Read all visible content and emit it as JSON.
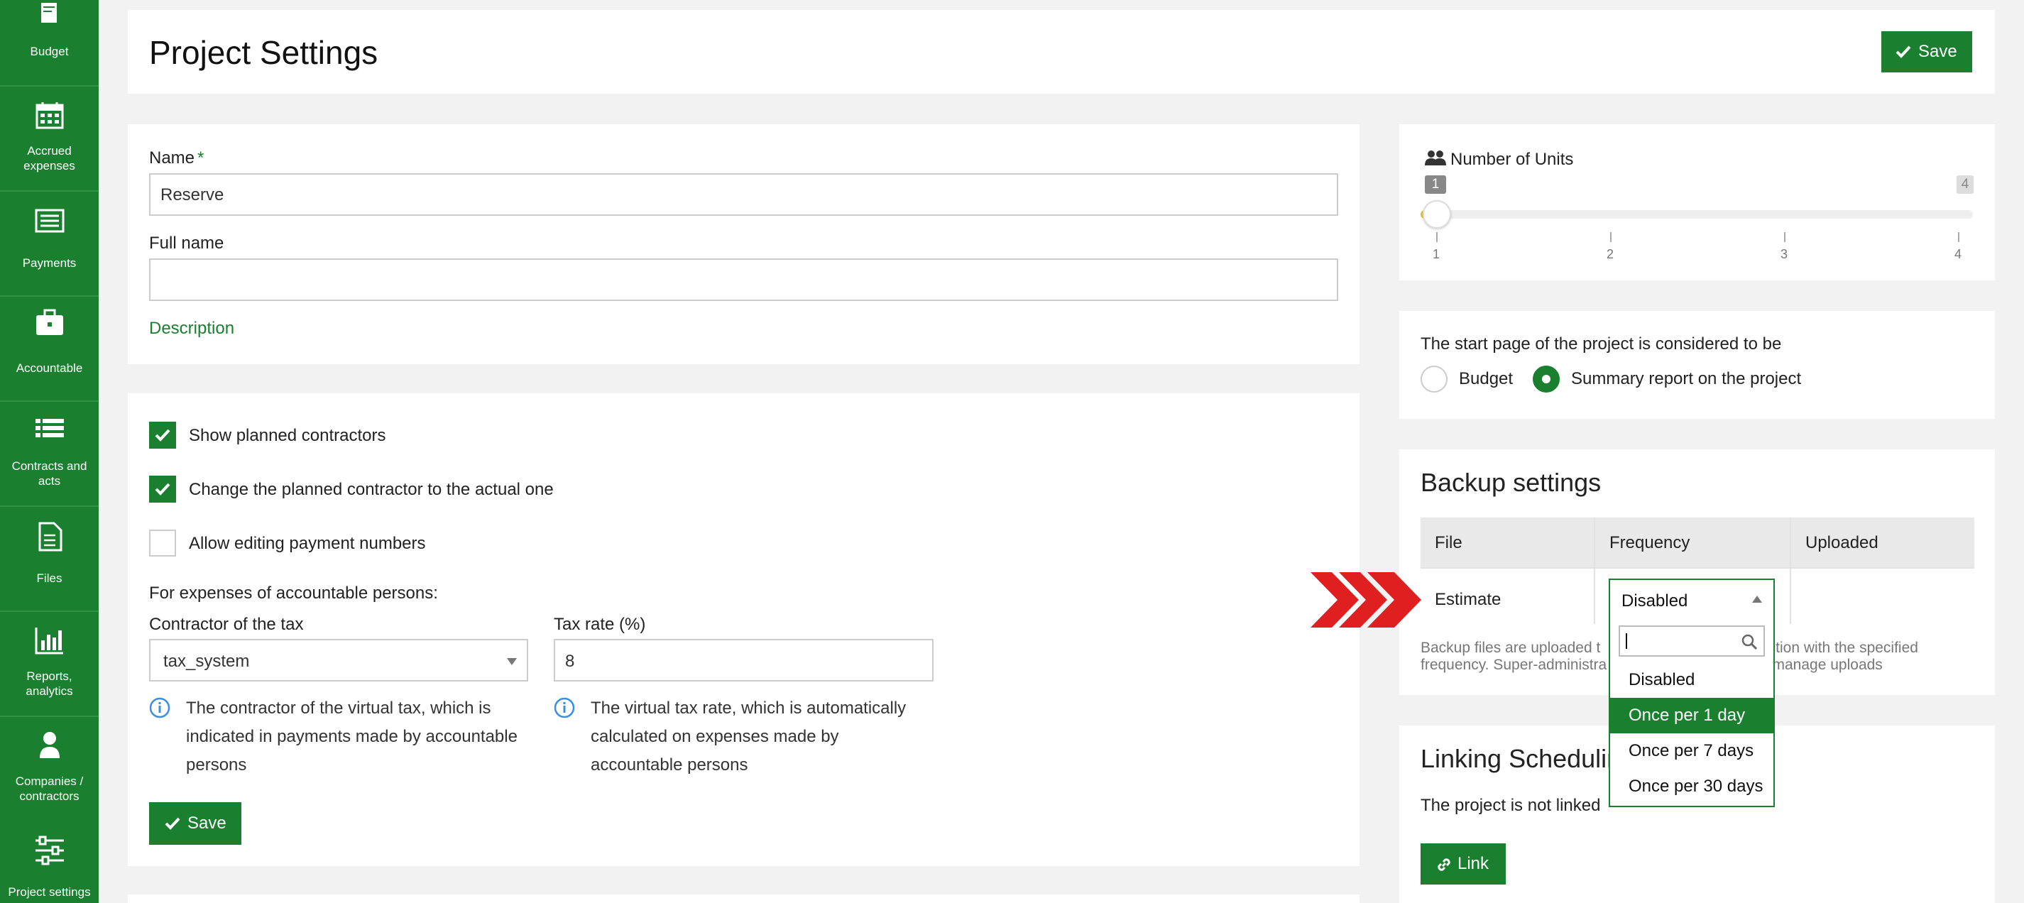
{
  "sidebar": {
    "items": [
      {
        "label": "Budget",
        "icon": "book-icon"
      },
      {
        "label": "Accrued expenses",
        "icon": "calendar-icon"
      },
      {
        "label": "Payments",
        "icon": "list-card-icon"
      },
      {
        "label": "Accountable",
        "icon": "briefcase-icon"
      },
      {
        "label": "Contracts and acts",
        "icon": "list-icon"
      },
      {
        "label": "Files",
        "icon": "file-icon"
      },
      {
        "label": "Reports, analytics",
        "icon": "bar-chart-icon"
      },
      {
        "label": "Companies / contractors",
        "icon": "user-icon"
      },
      {
        "label": "Project settings",
        "icon": "sliders-icon"
      }
    ]
  },
  "header": {
    "title": "Project Settings",
    "save_label": "Save"
  },
  "general": {
    "name_label": "Name",
    "required_mark": "*",
    "name_value": "Reserve",
    "fullname_label": "Full name",
    "fullname_value": "",
    "description_link": "Description"
  },
  "options": {
    "show_planned": "Show planned contractors",
    "change_planned": "Change the planned contractor to the actual one",
    "allow_editing": "Allow editing payment numbers",
    "expenses_heading": "For expenses of accountable persons:",
    "tax_contractor_label": "Contractor of the tax",
    "tax_contractor_value": "tax_system",
    "tax_rate_label": "Tax rate (%)",
    "tax_rate_value": "8",
    "tax_contractor_info": [
      "The contractor of the virtual tax, which is",
      "indicated in payments made by accountable",
      "persons"
    ],
    "tax_rate_info": [
      "The virtual tax rate, which is automatically",
      "calculated on expenses made by",
      "accountable persons"
    ],
    "save_label": "Save"
  },
  "units": {
    "title": "Number of Units",
    "min_badge": "1",
    "max_badge": "4",
    "ticks": [
      "1",
      "2",
      "3",
      "4"
    ],
    "value_fraction": 0
  },
  "start_page": {
    "heading": "The start page of the project is considered to be",
    "opt_budget": "Budget",
    "opt_summary": "Summary report on the project"
  },
  "backup": {
    "title": "Backup settings",
    "col_file": "File",
    "col_frequency": "Frequency",
    "col_uploaded": "Uploaded",
    "row_file": "Estimate",
    "row_frequency": "Disabled",
    "note_line1_left": "Backup files are uploaded t",
    "note_line1_right": "ection with the specified",
    "note_line2_left": "frequency. Super-administra",
    "note_line2_right": "o manage uploads",
    "dropdown_options": [
      "Disabled",
      "Once per 1 day",
      "Once per 7 days",
      "Once per 30 days"
    ]
  },
  "linking": {
    "title": "Linking Schedulin",
    "status": "The project is not linked",
    "link_label": "Link"
  },
  "colors": {
    "accent": "#1a7f2e",
    "arrow": "#e02020"
  }
}
